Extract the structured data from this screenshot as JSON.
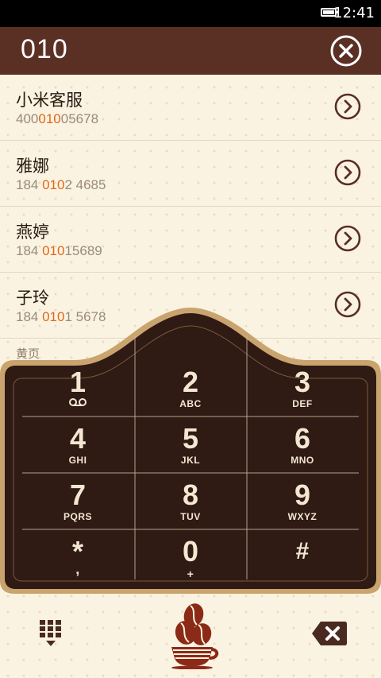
{
  "status_bar": {
    "time": "12:41"
  },
  "header": {
    "number": "010"
  },
  "contacts": [
    {
      "name": "小米客服",
      "phone_pre": "400",
      "phone_match": "010",
      "phone_post": "05678"
    },
    {
      "name": "雅娜",
      "phone_pre": "184 ",
      "phone_match": "010",
      "phone_post": "2 4685"
    },
    {
      "name": "燕婷",
      "phone_pre": "184 ",
      "phone_match": "010",
      "phone_post": "15689"
    },
    {
      "name": "子玲",
      "phone_pre": "184 ",
      "phone_match": "010",
      "phone_post": "1 5678"
    }
  ],
  "yellow_pages": "黄页",
  "keys": [
    {
      "digit": "1",
      "letters": ""
    },
    {
      "digit": "2",
      "letters": "ABC"
    },
    {
      "digit": "3",
      "letters": "DEF"
    },
    {
      "digit": "4",
      "letters": "GHI"
    },
    {
      "digit": "5",
      "letters": "JKL"
    },
    {
      "digit": "6",
      "letters": "MNO"
    },
    {
      "digit": "7",
      "letters": "PQRS"
    },
    {
      "digit": "8",
      "letters": "TUV"
    },
    {
      "digit": "9",
      "letters": "WXYZ"
    },
    {
      "digit": "*",
      "letters": ","
    },
    {
      "digit": "0",
      "letters": "+"
    },
    {
      "digit": "#",
      "letters": ""
    }
  ],
  "colors": {
    "header_bg": "#5a2f24",
    "keypad_bg": "#2f1a14",
    "keypad_border": "#c9a46e",
    "match_highlight": "#e2661b",
    "background": "#fbf3e2"
  },
  "icons": {
    "clear": "close-circle-icon",
    "detail": "chevron-right-circle-icon",
    "voicemail": "voicemail-icon",
    "dialpad": "dialpad-icon",
    "coffee": "coffee-cup-icon",
    "backspace": "backspace-icon"
  }
}
